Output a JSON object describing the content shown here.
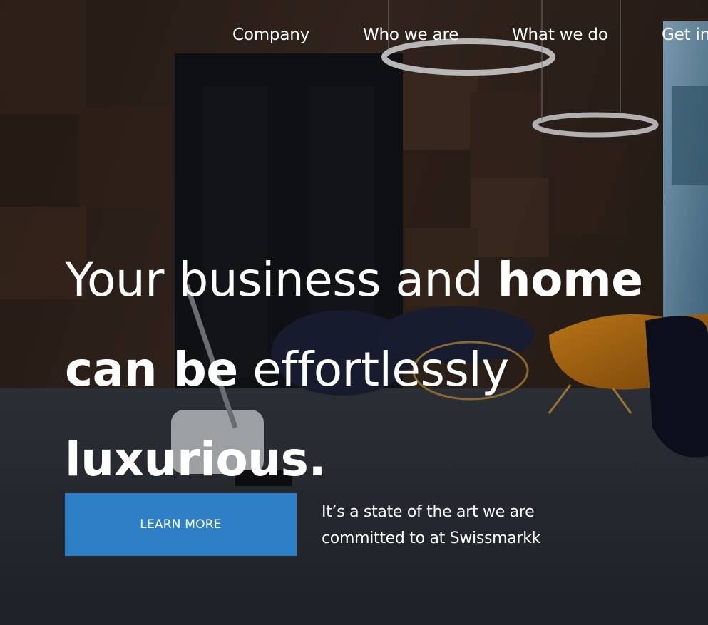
{
  "nav": {
    "items": [
      {
        "label": "Company"
      },
      {
        "label": "Who we are"
      },
      {
        "label": "What we do"
      },
      {
        "label": "Get in"
      }
    ]
  },
  "hero": {
    "headline": {
      "line1_light": "Your business and ",
      "line1_bold": "home",
      "line2_bold": "can be",
      "line2_light": " effortlessly",
      "line3_bold": "luxurious."
    },
    "cta_label": "LEARN MORE",
    "tagline": "It’s a state of the art we are committed to at Swissmarkk"
  },
  "colors": {
    "accent": "#2f7fc6",
    "text": "#ffffff"
  }
}
